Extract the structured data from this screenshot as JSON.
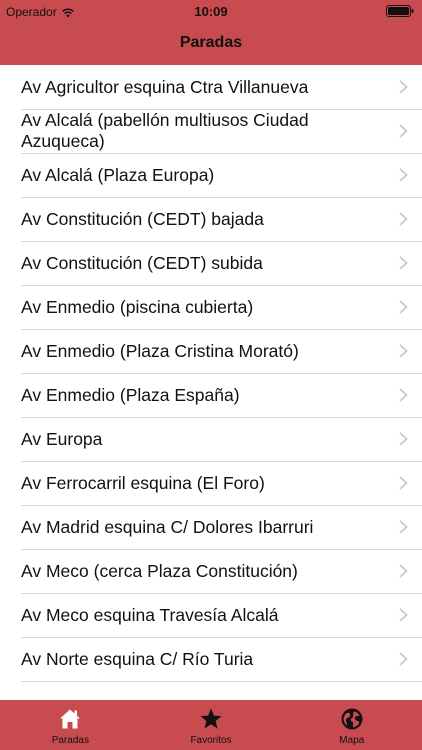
{
  "status_bar": {
    "carrier": "Operador",
    "time": "10:09"
  },
  "nav": {
    "title": "Paradas"
  },
  "stops": [
    "Av Agricultor esquina Ctra Villanueva",
    "Av Alcalá (pabellón multiusos Ciudad Azuqueca)",
    "Av Alcalá (Plaza Europa)",
    "Av Constitución (CEDT) bajada",
    "Av Constitución (CEDT) subida",
    "Av Enmedio (piscina cubierta)",
    "Av Enmedio (Plaza Cristina Morató)",
    "Av Enmedio (Plaza España)",
    "Av Europa",
    "Av Ferrocarril esquina (El Foro)",
    "Av Madrid esquina C/ Dolores Ibarruri",
    "Av Meco (cerca Plaza Constitución)",
    "Av Meco esquina Travesía Alcalá",
    "Av Norte esquina C/ Río Turia"
  ],
  "tabs": [
    {
      "label": "Paradas",
      "icon": "home-icon"
    },
    {
      "label": "Favoritos",
      "icon": "star-icon"
    },
    {
      "label": "Mapa",
      "icon": "globe-icon"
    }
  ],
  "colors": {
    "accent": "#c84b4f"
  }
}
